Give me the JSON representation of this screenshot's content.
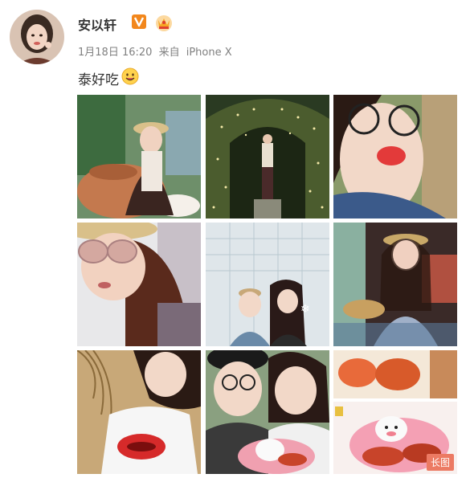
{
  "post": {
    "author": "安以轩",
    "time": "1月18日 16:20",
    "source_prefix": "来自",
    "source": "iPhone X",
    "text": "泰好吃",
    "emoji": "smile-emoji"
  },
  "badges": {
    "verified": "verified-v-icon",
    "vip": "vip-crown-icon"
  },
  "photos": {
    "count": 9,
    "long_label": "长图"
  },
  "colors": {
    "vip_orange": "#f5a623",
    "verified_orange": "#f2871c",
    "long_badge": "#ec7a63"
  }
}
